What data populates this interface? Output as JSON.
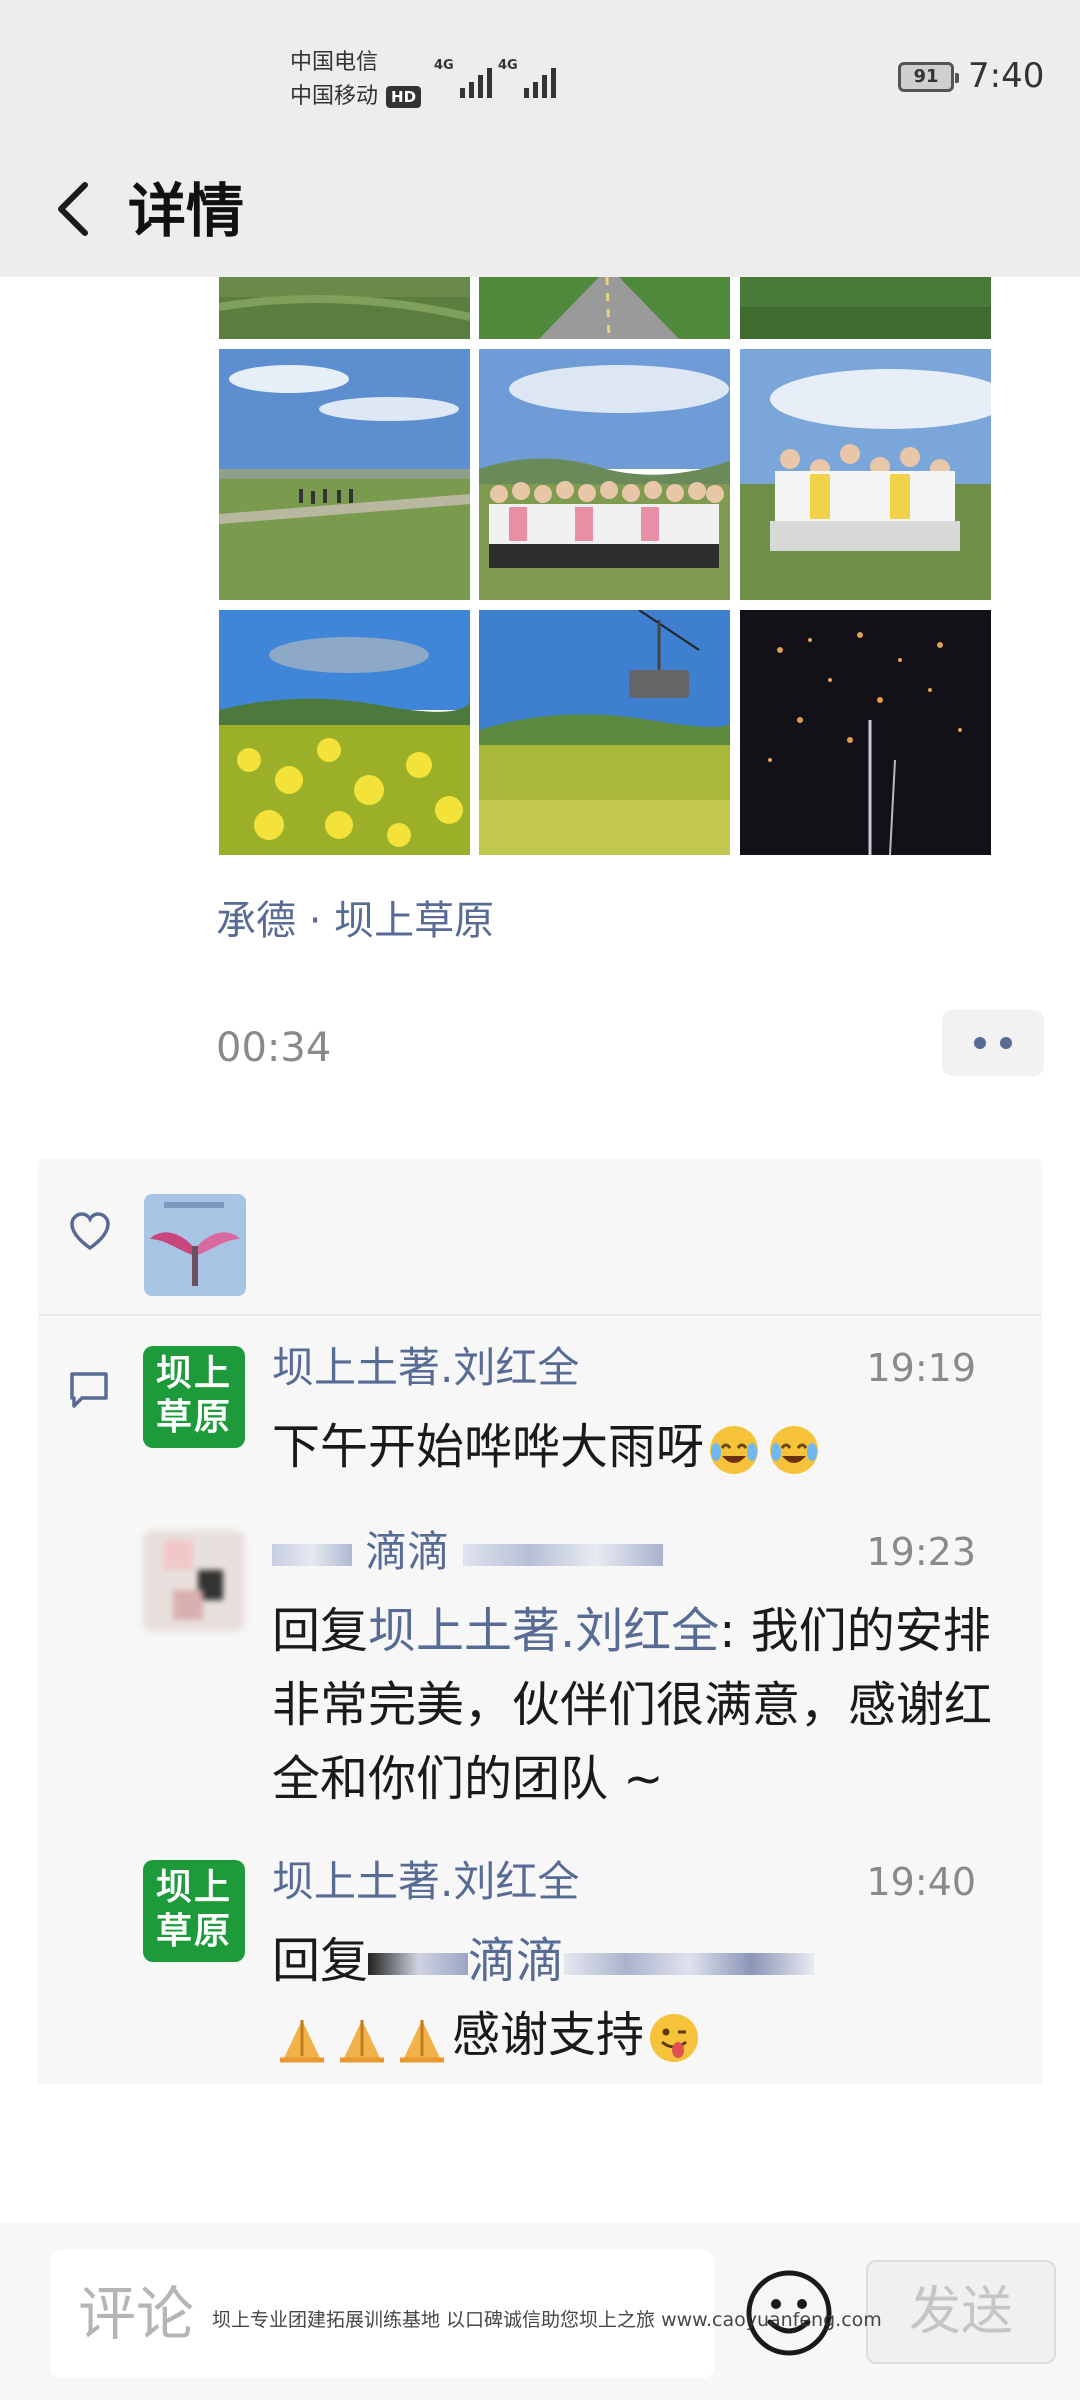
{
  "status_bar": {
    "carrier_1": "中国电信",
    "carrier_2": "中国移动",
    "hd_badge": "HD",
    "network_1": "4G",
    "network_2": "4G",
    "battery": "91",
    "time": "7:40"
  },
  "header": {
    "title": "详情",
    "back_icon": "chevron-left-icon"
  },
  "post": {
    "photos": [
      {
        "icon": "road-photo"
      },
      {
        "icon": "road-photo"
      },
      {
        "icon": "grass-photo"
      },
      {
        "icon": "grassland-photo"
      },
      {
        "icon": "group-photo"
      },
      {
        "icon": "group-photo"
      },
      {
        "icon": "flower-field-photo"
      },
      {
        "icon": "cable-car-photo"
      },
      {
        "icon": "fireworks-photo"
      }
    ],
    "location": "承德 · 坝上草原",
    "time": "00:34",
    "more_icon": "more-dots-icon"
  },
  "likes": {
    "icon": "heart-icon",
    "avatars": [
      {
        "icon": "angel-wings-avatar"
      }
    ]
  },
  "comments": {
    "icon": "comment-icon",
    "items": [
      {
        "avatar_line1": "坝上",
        "avatar_line2": "草原",
        "name": "坝上土著.刘红全",
        "time": "19:19",
        "text": "下午开始哗哗大雨呀"
      },
      {
        "name_prefix": "滴滴",
        "time": "19:23",
        "reply_prefix": "回复",
        "reply_to": "坝上土著.刘红全",
        "text": ": 我们的安排非常完美，伙伴们很满意，感谢红全和你们的团队 ~"
      },
      {
        "avatar_line1": "坝上",
        "avatar_line2": "草原",
        "name": "坝上土著.刘红全",
        "time": "19:40",
        "reply_prefix": "回复",
        "reply_to": "滴滴",
        "text": "感谢支持"
      }
    ]
  },
  "input_bar": {
    "placeholder": "评论",
    "emoji_icon": "smiley-icon",
    "send_label": "发送"
  },
  "watermark": "坝上专业团建拓展训练基地 以口碑诚信助您坝上之旅 www.caoyuanfeng.com"
}
